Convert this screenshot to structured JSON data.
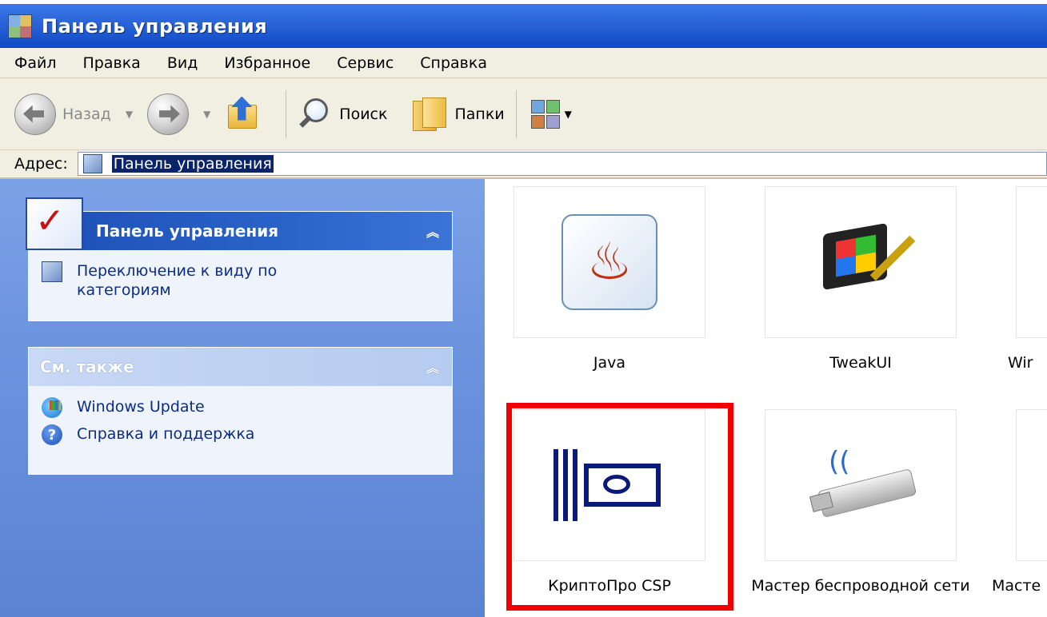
{
  "window": {
    "title": "Панель управления"
  },
  "menu": {
    "items": [
      "Файл",
      "Правка",
      "Вид",
      "Избранное",
      "Сервис",
      "Справка"
    ]
  },
  "toolbar": {
    "back_label": "Назад",
    "search_label": "Поиск",
    "folders_label": "Папки"
  },
  "address": {
    "label": "Адрес:",
    "value": "Панель управления"
  },
  "taskpane": {
    "panel1": {
      "title": "Панель управления",
      "items": [
        "Переключение к виду по категориям"
      ]
    },
    "panel2": {
      "title": "См. также",
      "items": [
        "Windows Update",
        "Справка и поддержка"
      ]
    }
  },
  "content": {
    "items": [
      {
        "label": "Java",
        "icon": "java-icon"
      },
      {
        "label": "TweakUI",
        "icon": "tweakui-icon"
      },
      {
        "label": "Wir",
        "icon": "partial-icon"
      },
      {
        "label": "КриптоПро CSP",
        "icon": "cryptopro-icon"
      },
      {
        "label": "Мастер беспроводной сети",
        "icon": "usb-wireless-icon"
      },
      {
        "label": "Масте",
        "icon": "partial-icon"
      }
    ],
    "highlight_color": "#f00000"
  },
  "colors": {
    "titlebar": "#2962d9",
    "taskpane": "#6b93de",
    "link": "#0c2d84"
  }
}
